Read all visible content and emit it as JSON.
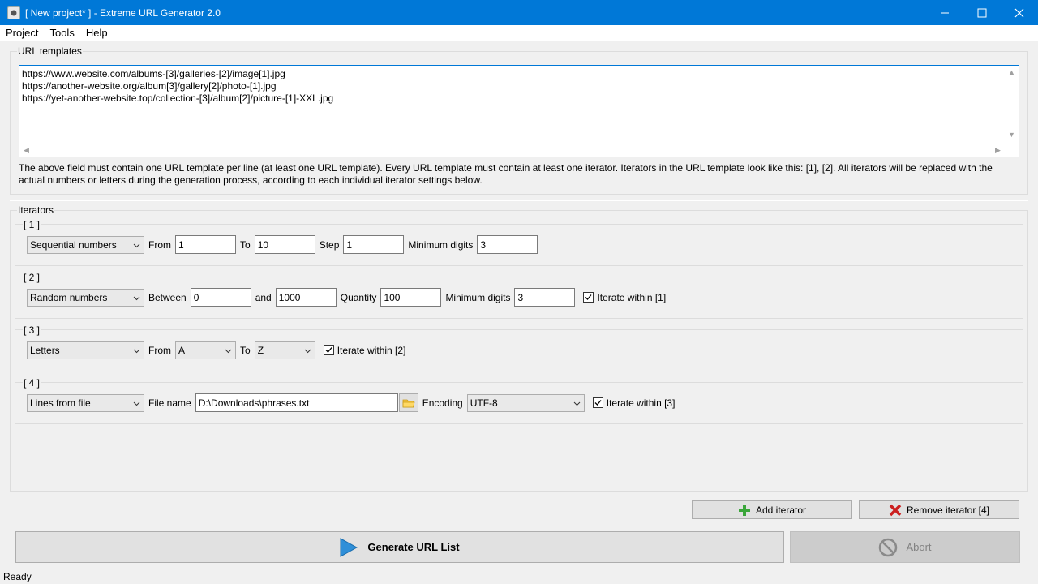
{
  "window": {
    "title": "[ New project* ] - Extreme URL Generator 2.0",
    "accent": "#0078d7"
  },
  "menu": [
    "Project",
    "Tools",
    "Help"
  ],
  "url_templates": {
    "group_label": "URL templates",
    "lines": [
      "https://www.website.com/albums-[3]/galleries-[2]/image[1].jpg",
      "https://another-website.org/album[3]/gallery[2]/photo-[1].jpg",
      "https://yet-another-website.top/collection-[3]/album[2]/picture-[1]-XXL.jpg"
    ],
    "help_text": "The above field must contain one URL template per line (at least one URL template). Every URL template must contain at least one iterator. Iterators in the URL template look like this: [1], [2]. All iterators will be replaced with the actual numbers or letters during the generation process, according to each individual iterator settings below."
  },
  "iterators": {
    "group_label": "Iterators",
    "it1": {
      "label": "[ 1 ]",
      "type": "Sequential numbers",
      "from_label": "From",
      "from": "1",
      "to_label": "To",
      "to": "10",
      "step_label": "Step",
      "step": "1",
      "mindigits_label": "Minimum digits",
      "mindigits": "3"
    },
    "it2": {
      "label": "[ 2 ]",
      "type": "Random numbers",
      "between_label": "Between",
      "between": "0",
      "and_label": "and",
      "and": "1000",
      "quantity_label": "Quantity",
      "quantity": "100",
      "mindigits_label": "Minimum digits",
      "mindigits": "3",
      "iterate_within": "Iterate within [1]"
    },
    "it3": {
      "label": "[ 3 ]",
      "type": "Letters",
      "from_label": "From",
      "from": "A",
      "to_label": "To",
      "to": "Z",
      "iterate_within": "Iterate within [2]"
    },
    "it4": {
      "label": "[ 4 ]",
      "type": "Lines from file",
      "file_label": "File name",
      "file": "D:\\Downloads\\phrases.txt",
      "encoding_label": "Encoding",
      "encoding": "UTF-8",
      "iterate_within": "Iterate within [3]"
    }
  },
  "actions": {
    "add_iterator": "Add iterator",
    "remove_iterator": "Remove iterator [4]",
    "generate": "Generate URL List",
    "abort": "Abort"
  },
  "status": "Ready",
  "icons": {
    "add": "plus-icon",
    "remove": "x-icon",
    "generate": "play-icon",
    "abort": "no-entry-icon",
    "browse": "folder-icon"
  }
}
